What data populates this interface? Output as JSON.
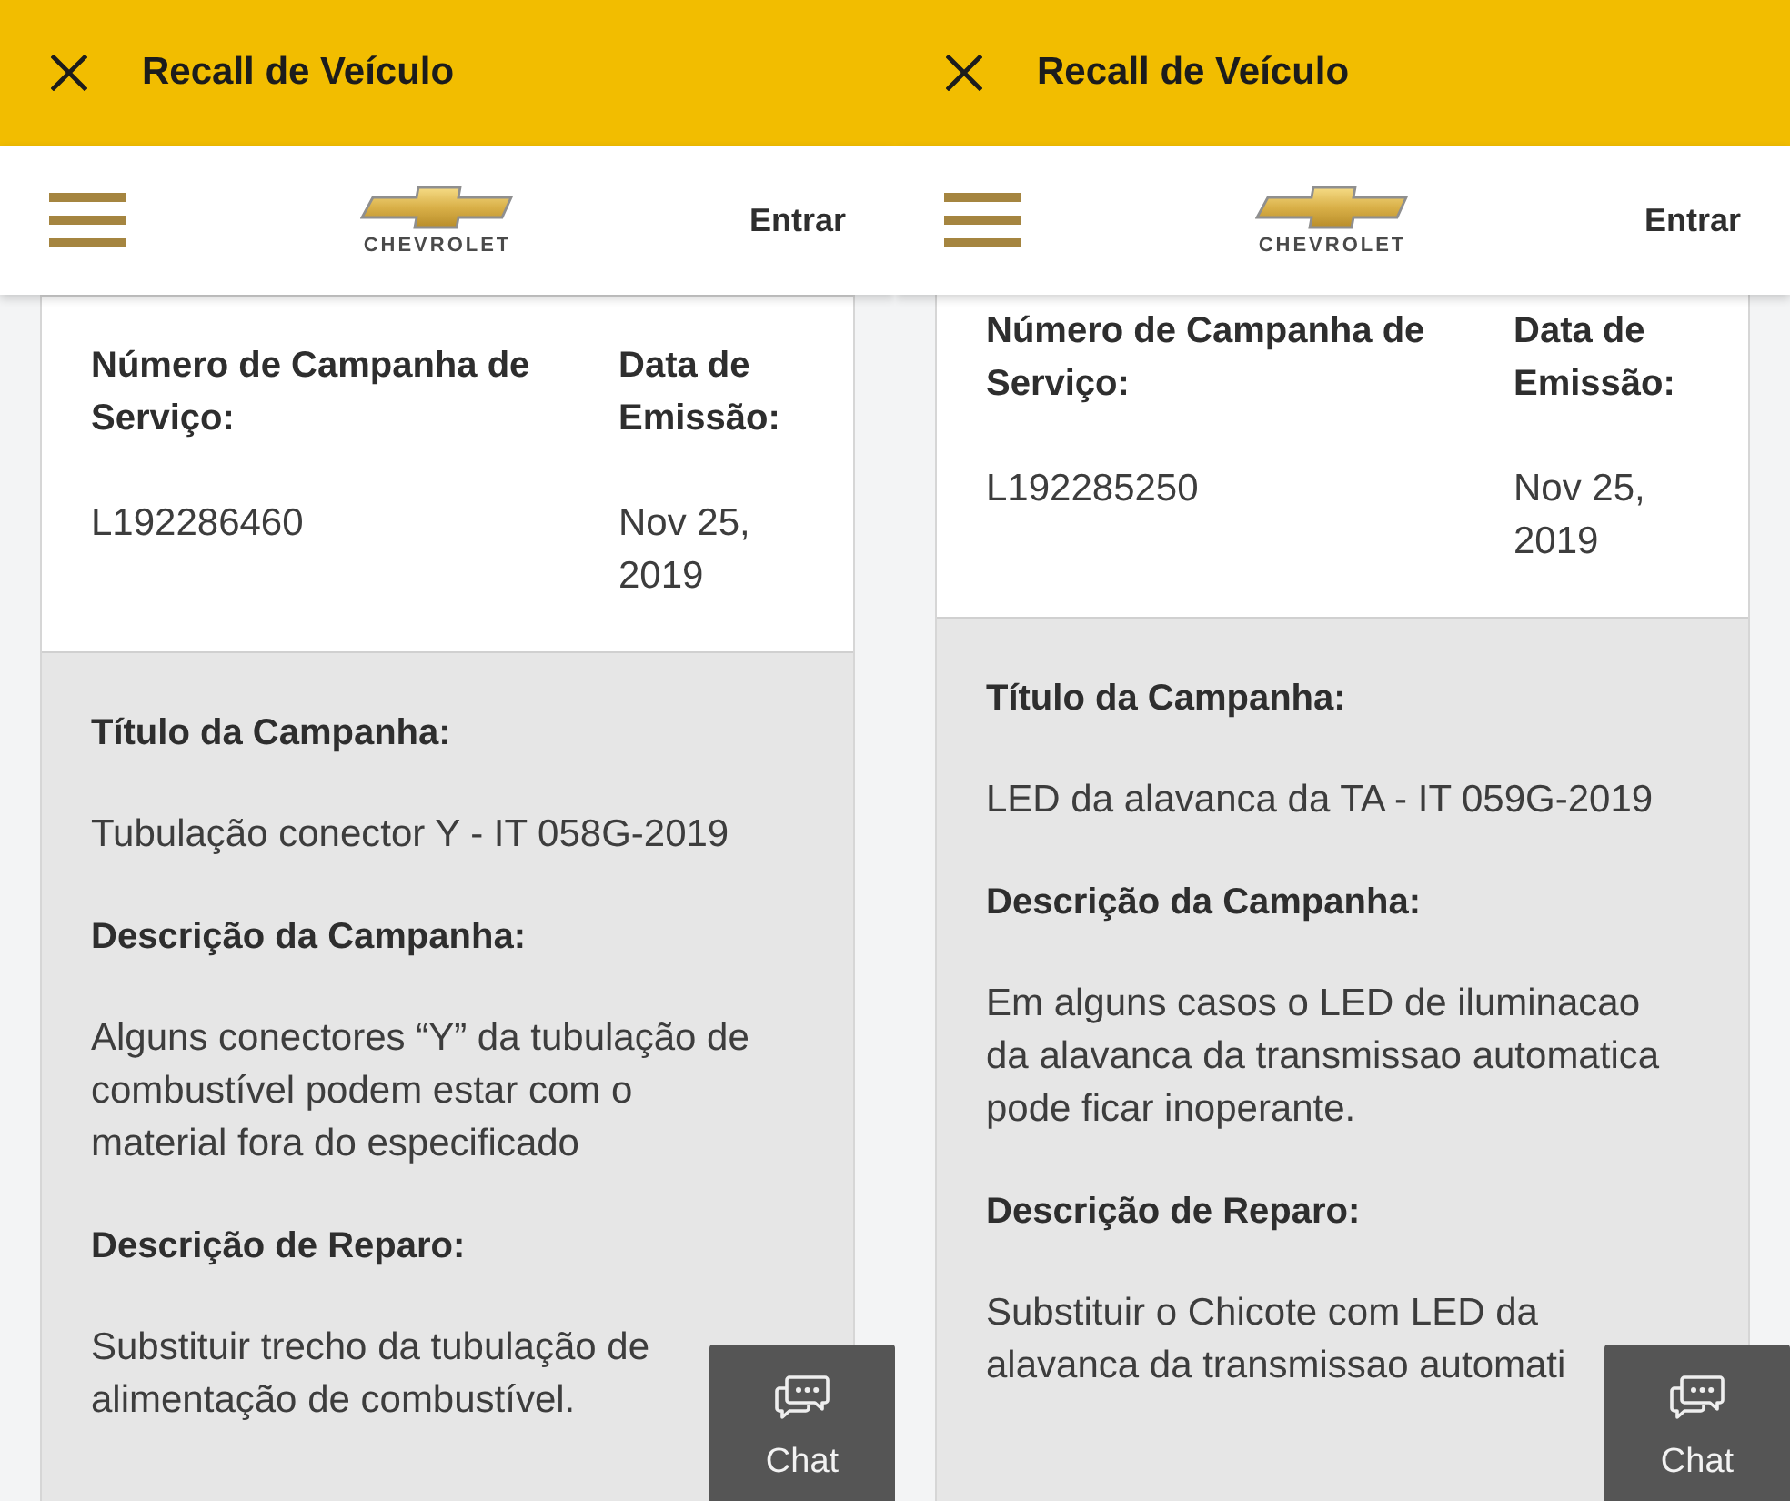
{
  "screens": [
    {
      "header": {
        "title": "Recall de Veículo"
      },
      "nav": {
        "logo_text": "CHEVROLET",
        "login_label": "Entrar"
      },
      "summary": {
        "number_label": "Número de Campanha de Serviço:",
        "number": "L192286460",
        "date_label": "Data de Emissão:",
        "date": "Nov 25, 2019"
      },
      "details": [
        {
          "label": "Título da Campanha:",
          "value": "Tubulação conector Y - IT 058G-2019"
        },
        {
          "label": "Descrição da Campanha:",
          "value": "Alguns conectores “Y” da tubulação de combustível podem estar com o material fora do especificado"
        },
        {
          "label": "Descrição de Reparo:",
          "value": "Substituir trecho da tubulação de alimentação de combustível."
        }
      ],
      "chat_button": {
        "label": "Chat"
      }
    },
    {
      "header": {
        "title": "Recall de Veículo"
      },
      "nav": {
        "logo_text": "CHEVROLET",
        "login_label": "Entrar"
      },
      "summary": {
        "number_label": "Número de Campanha de Serviço:",
        "number": "L192285250",
        "date_label": "Data de Emissão:",
        "date": "Nov 25, 2019"
      },
      "details": [
        {
          "label": "Título da Campanha:",
          "value": "LED da alavanca da TA - IT 059G-2019"
        },
        {
          "label": "Descrição da Campanha:",
          "value": "Em alguns casos o LED de iluminacao da alavanca da transmissao automatica pode ficar inoperante."
        },
        {
          "label": "Descrição de Reparo:",
          "value": "Substituir o Chicote com LED da alavanca da transmissao automati"
        }
      ],
      "chat_button": {
        "label": "Chat"
      }
    }
  ]
}
